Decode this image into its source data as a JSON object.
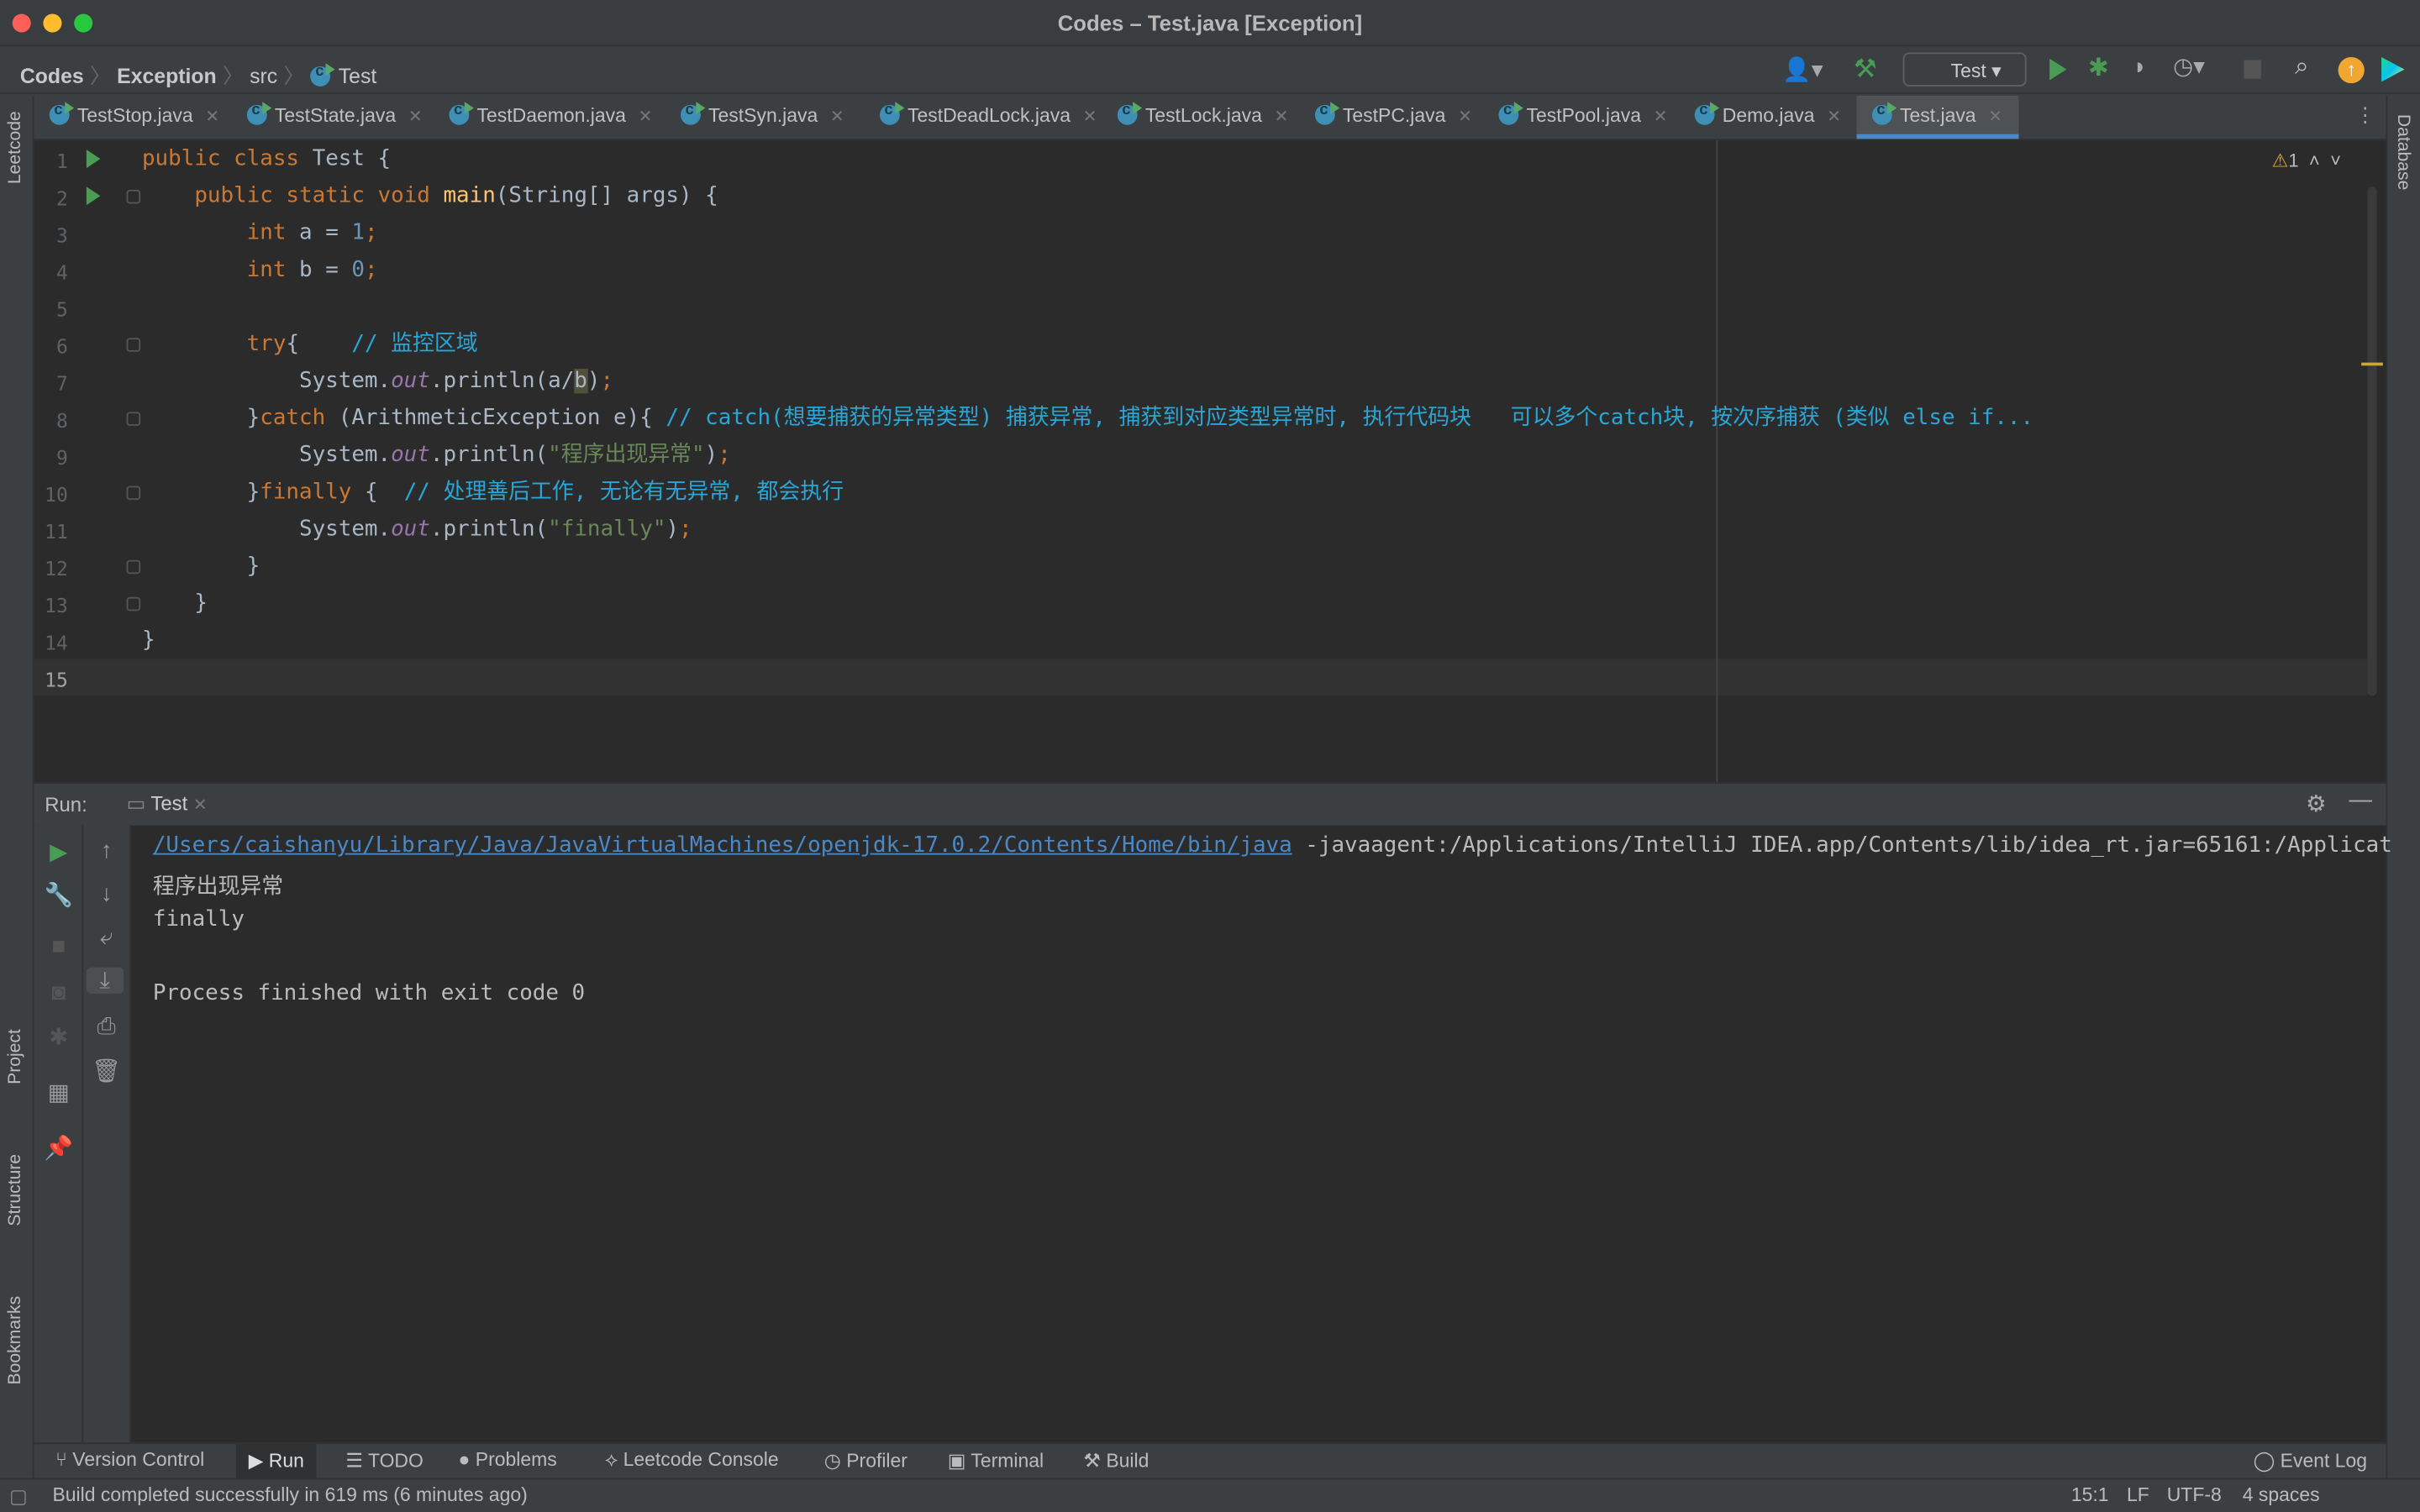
{
  "window": {
    "title": "Codes – Test.java [Exception]"
  },
  "breadcrumb": [
    "Codes",
    "Exception",
    "src",
    "Test"
  ],
  "toolbar": {
    "run_config": "Test",
    "icons": [
      "user-icon",
      "build-hammer-icon",
      "run-icon",
      "debug-icon",
      "coverage-icon",
      "profile-icon",
      "stop-icon",
      "search-icon",
      "update-icon",
      "toolbox-icon"
    ]
  },
  "tabs": [
    {
      "label": "TestStop.java",
      "active": false
    },
    {
      "label": "TestState.java",
      "active": false
    },
    {
      "label": "TestDaemon.java",
      "active": false
    },
    {
      "label": "TestSyn.java",
      "active": false
    },
    {
      "label": "TestDeadLock.java",
      "active": false
    },
    {
      "label": "TestLock.java",
      "active": false
    },
    {
      "label": "TestPC.java",
      "active": false
    },
    {
      "label": "TestPool.java",
      "active": false
    },
    {
      "label": "Demo.java",
      "active": false
    },
    {
      "label": "Test.java",
      "active": true
    }
  ],
  "left_strip": {
    "top": "Leetcode",
    "project": "Project",
    "structure": "Structure",
    "bookmarks": "Bookmarks"
  },
  "right_strip": {
    "database": "Database"
  },
  "editor": {
    "warning_count": "1",
    "current_line": 15,
    "lines": [
      [
        [
          "kw",
          "public "
        ],
        [
          "kw",
          "class "
        ],
        [
          "pl",
          "Test {"
        ]
      ],
      [
        [
          "pl",
          "    "
        ],
        [
          "kw",
          "public static void "
        ],
        [
          "fn",
          "main"
        ],
        [
          "pl",
          "(String[] args) {"
        ]
      ],
      [
        [
          "pl",
          "        "
        ],
        [
          "kw",
          "int "
        ],
        [
          "pl",
          "a = "
        ],
        [
          "num",
          "1"
        ],
        [
          "kw",
          ";"
        ]
      ],
      [
        [
          "pl",
          "        "
        ],
        [
          "kw",
          "int "
        ],
        [
          "pl",
          "b = "
        ],
        [
          "num",
          "0"
        ],
        [
          "kw",
          ";"
        ]
      ],
      [],
      [
        [
          "pl",
          "        "
        ],
        [
          "kw",
          "try"
        ],
        [
          "pl",
          "{    "
        ],
        [
          "cm",
          "// 监控区域"
        ]
      ],
      [
        [
          "pl",
          "            System."
        ],
        [
          "st",
          "out"
        ],
        [
          "pl",
          ".println(a/"
        ],
        [
          "hl",
          "b"
        ],
        [
          "pl",
          ")"
        ],
        [
          "kw",
          ";"
        ]
      ],
      [
        [
          "pl",
          "        }"
        ],
        [
          "kw",
          "catch "
        ],
        [
          "pl",
          "(ArithmeticException e){ "
        ],
        [
          "cm",
          "// catch(想要捕获的异常类型) 捕获异常, 捕获到对应类型异常时, 执行代码块   可以多个catch块, 按次序捕获 (类似 else if..."
        ]
      ],
      [
        [
          "pl",
          "            System."
        ],
        [
          "st",
          "out"
        ],
        [
          "pl",
          ".println("
        ],
        [
          "str",
          "\"程序出现异常\""
        ],
        [
          "pl",
          ")"
        ],
        [
          "kw",
          ";"
        ]
      ],
      [
        [
          "pl",
          "        }"
        ],
        [
          "kw",
          "finally "
        ],
        [
          "pl",
          "{  "
        ],
        [
          "cm",
          "// 处理善后工作, 无论有无异常, 都会执行"
        ]
      ],
      [
        [
          "pl",
          "            System."
        ],
        [
          "st",
          "out"
        ],
        [
          "pl",
          ".println("
        ],
        [
          "str",
          "\"finally\""
        ],
        [
          "pl",
          ")"
        ],
        [
          "kw",
          ";"
        ]
      ],
      [
        [
          "pl",
          "        }"
        ]
      ],
      [
        [
          "pl",
          "    }"
        ]
      ],
      [
        [
          "pl",
          "}"
        ]
      ],
      []
    ]
  },
  "run": {
    "label": "Run:",
    "tab": "Test",
    "output": [
      {
        "link": "/Users/caishanyu/Library/Java/JavaVirtualMachines/openjdk-17.0.2/Contents/Home/bin/java",
        "text": " -javaagent:/Applications/IntelliJ IDEA.app/Contents/lib/idea_rt.jar=65161:/Applicat"
      },
      {
        "text": "程序出现异常"
      },
      {
        "text": "finally"
      },
      {
        "text": ""
      },
      {
        "text": "Process finished with exit code 0"
      }
    ]
  },
  "bottom_tabs": [
    "Version Control",
    "Run",
    "TODO",
    "Problems",
    "Leetcode Console",
    "Profiler",
    "Terminal",
    "Build"
  ],
  "event_log": "Event Log",
  "status": {
    "message": "Build completed successfully in 619 ms (6 minutes ago)",
    "position": "15:1",
    "line_sep": "LF",
    "encoding": "UTF-8",
    "indent": "4 spaces"
  }
}
